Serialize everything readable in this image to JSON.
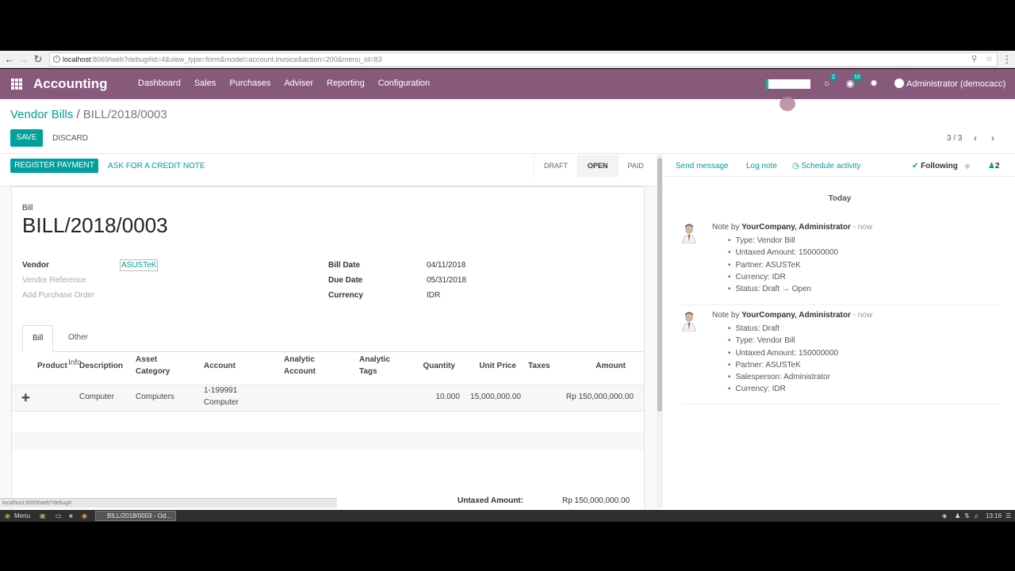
{
  "browser": {
    "url_host": "localhost",
    "url_rest": ":8069/web?debug#id=4&view_type=form&model=account.invoice&action=200&menu_id=83"
  },
  "topbar": {
    "app_title": "Accounting",
    "menu": [
      "Dashboard",
      "Sales",
      "Purchases",
      "Adviser",
      "Reporting",
      "Configuration"
    ],
    "discuss_badge": "2",
    "activity_badge": "10",
    "user": "Administrator (democacc)"
  },
  "breadcrumb": {
    "parent": "Vendor Bills",
    "separator": "/",
    "current": "BILL/2018/0003"
  },
  "control": {
    "save_label": "SAVE",
    "discard_label": "DISCARD",
    "pager": "3 / 3"
  },
  "form_header": {
    "register_payment": "REGISTER PAYMENT",
    "credit_note": "ASK FOR A CREDIT NOTE",
    "steps": [
      "DRAFT",
      "OPEN",
      "PAID"
    ],
    "active_step": "OPEN"
  },
  "bill": {
    "kind_label": "Bill",
    "name": "BILL/2018/0003",
    "vendor_label": "Vendor",
    "vendor_value": "ASUSTeK",
    "vendor_ref_label": "Vendor Reference",
    "add_po_label": "Add Purchase Order",
    "bill_date_label": "Bill Date",
    "bill_date_value": "04/11/2018",
    "due_date_label": "Due Date",
    "due_date_value": "05/31/2018",
    "currency_label": "Currency",
    "currency_value": "IDR"
  },
  "tabs": [
    "Bill",
    "Other Info"
  ],
  "lines": {
    "headers": {
      "product": "Product",
      "description": "Description",
      "asset_category_1": "Asset",
      "asset_category_2": "Category",
      "account": "Account",
      "analytic_account_1": "Analytic",
      "analytic_account_2": "Account",
      "analytic_tags_1": "Analytic",
      "analytic_tags_2": "Tags",
      "quantity": "Quantity",
      "unit_price": "Unit Price",
      "taxes": "Taxes",
      "amount": "Amount"
    },
    "row": {
      "description": "Computer",
      "asset_category": "Computers",
      "account_1": "1-199991",
      "account_2": "Computer",
      "quantity": "10.000",
      "unit_price": "15,000,000.00",
      "amount": "Rp 150,000,000.00"
    }
  },
  "totals": {
    "untaxed_label": "Untaxed Amount:",
    "untaxed_value": "Rp 150,000,000.00"
  },
  "chatter": {
    "send_message": "Send message",
    "log_note": "Log note",
    "schedule_activity": "Schedule activity",
    "following": "Following",
    "followers": "2",
    "today": "Today",
    "messages": [
      {
        "prefix": "Note by",
        "author": "YourCompany, Administrator",
        "time": "- now",
        "items": [
          "Type: Vendor Bill",
          "Untaxed Amount: 150000000",
          "Partner: ASUSTeK",
          "Currency: IDR",
          "Status: Draft → Open"
        ]
      },
      {
        "prefix": "Note by",
        "author": "YourCompany, Administrator",
        "time": "- now",
        "items": [
          "Status: Draft",
          "Type: Vendor Bill",
          "Untaxed Amount: 150000000",
          "Partner: ASUSTeK",
          "Salesperson: Administrator",
          "Currency: IDR"
        ]
      }
    ]
  },
  "status_url": "localhost:8069/web?debug#",
  "taskbar": {
    "menu": "Menu",
    "window": "BILL/2018/0003 - Od...",
    "clock": "13:16"
  },
  "colors": {
    "brand": "#875a7b",
    "accent": "#00a09d"
  }
}
